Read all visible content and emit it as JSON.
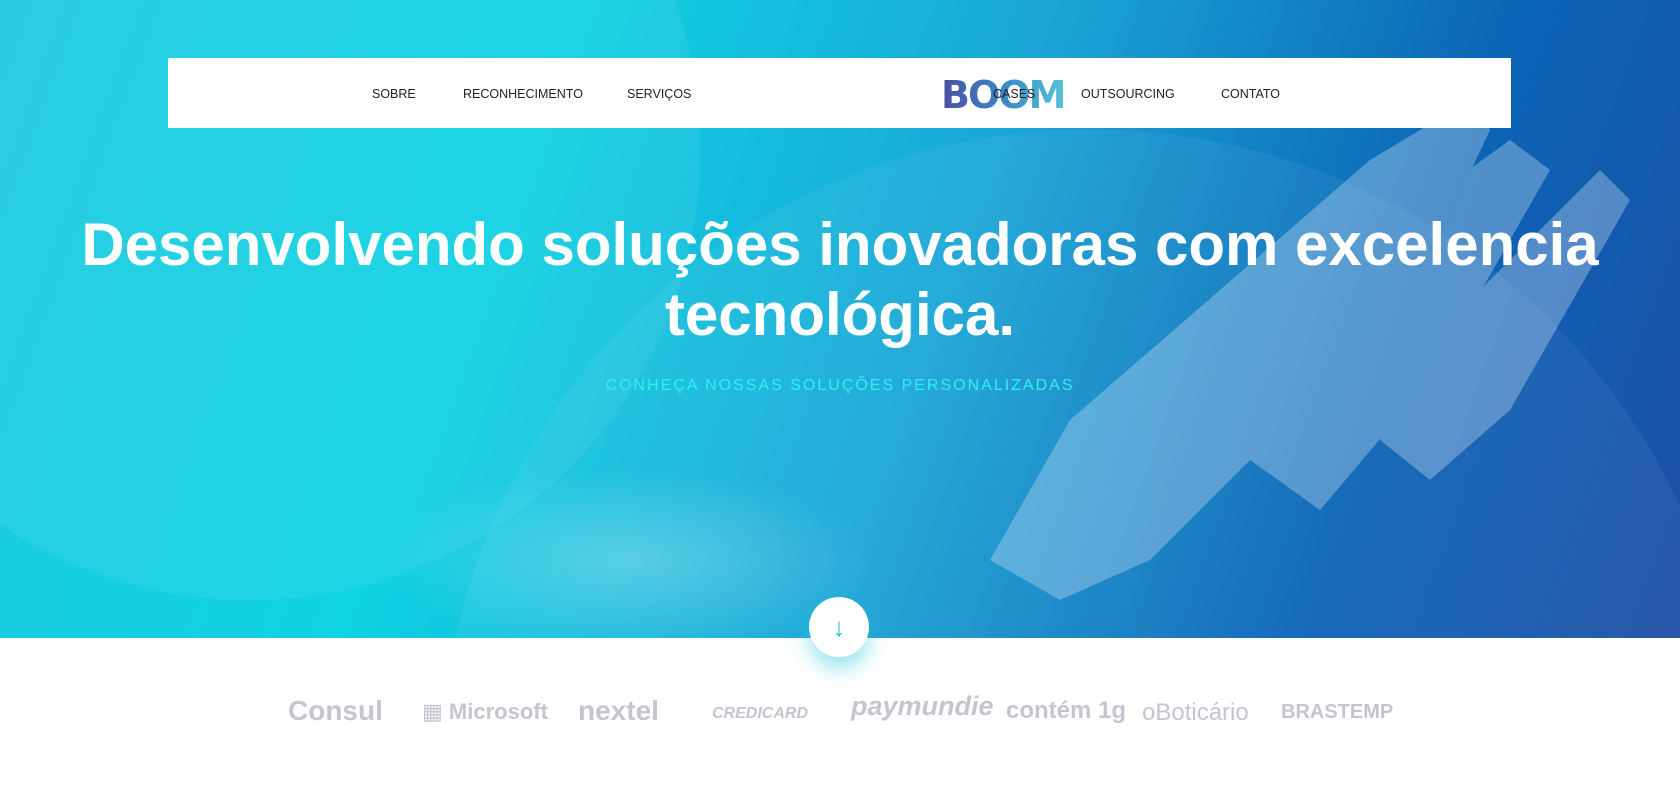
{
  "nav": {
    "left": [
      "SOBRE",
      "RECONHECIMENTO",
      "SERVIÇOS"
    ],
    "logo": "BOOM",
    "right": [
      "CASES",
      "OUTSOURCING",
      "CONTATO"
    ]
  },
  "hero": {
    "title_line1": "Desenvolvendo soluções inovadoras com excelencia",
    "title_line2": "tecnológica.",
    "subtitle": "CONHEÇA NOSSAS SOLUÇÕES PERSONALIZADAS",
    "scroll_icon": "arrow-down-icon"
  },
  "clients": [
    "Consul",
    "Microsoft",
    "nextel",
    "CREDICARD",
    "paymundie",
    "contém 1g",
    "oBoticário",
    "BRASTEMP"
  ],
  "colors": {
    "accent": "#2ef0f0",
    "logo_gray": "#c3c6cf"
  }
}
